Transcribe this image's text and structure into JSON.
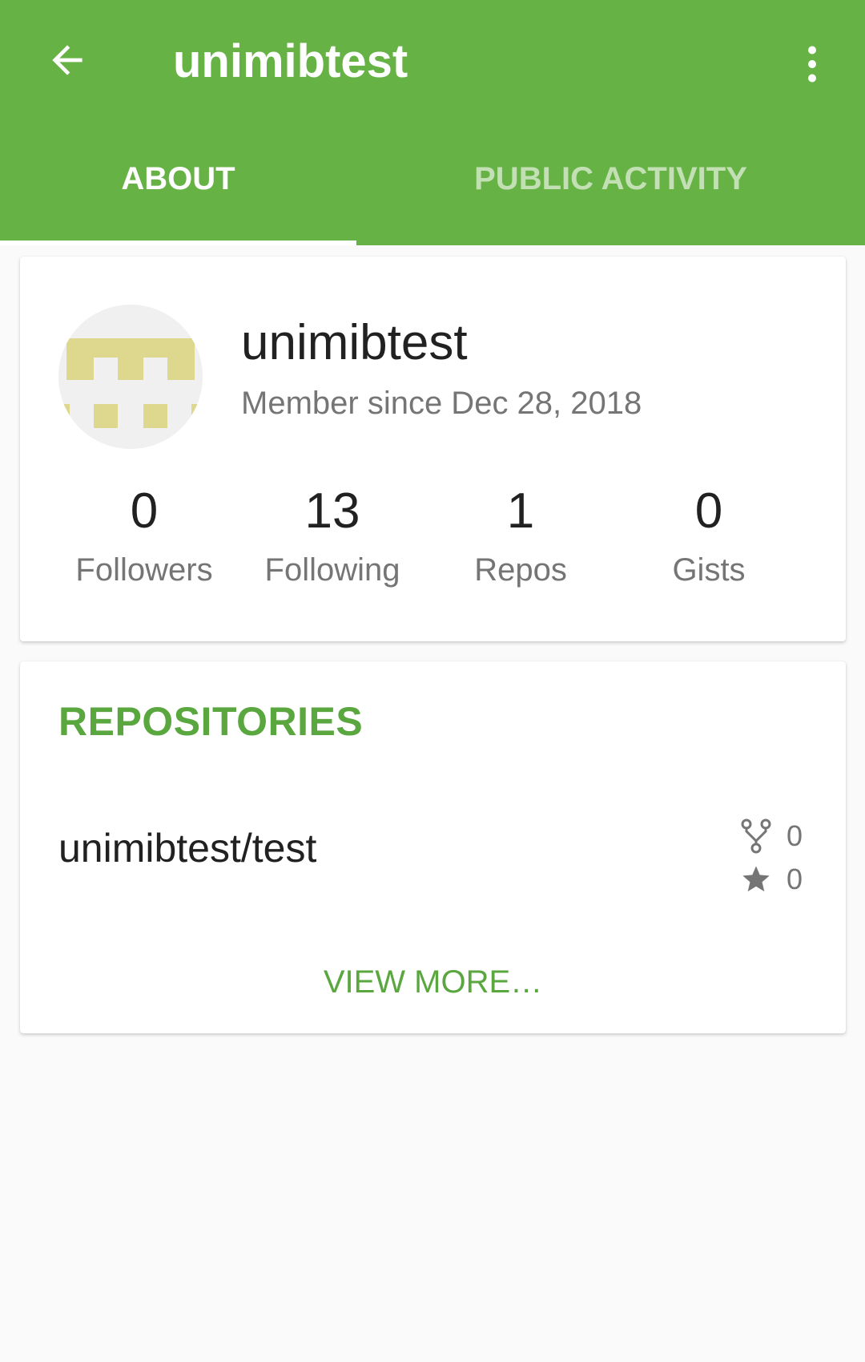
{
  "colors": {
    "primary": "#66b245",
    "accent_text": "#5aa63f",
    "background": "#fafafa",
    "card": "#ffffff",
    "avatar_pattern": "#ddd88e"
  },
  "toolbar": {
    "back_icon": "arrow-back-icon",
    "title": "unimibtest",
    "menu_icon": "more-vert-icon"
  },
  "tabs": [
    {
      "label": "ABOUT",
      "selected": true
    },
    {
      "label": "PUBLIC ACTIVITY",
      "selected": false
    }
  ],
  "profile": {
    "name": "unimibtest",
    "member_since": "Member since Dec 28, 2018",
    "stats": [
      {
        "value": "0",
        "label": "Followers"
      },
      {
        "value": "13",
        "label": "Following"
      },
      {
        "value": "1",
        "label": "Repos"
      },
      {
        "value": "0",
        "label": "Gists"
      }
    ]
  },
  "repositories": {
    "heading": "REPOSITORIES",
    "items": [
      {
        "name": "unimibtest/test",
        "forks": "0",
        "stars": "0"
      }
    ],
    "view_more": "VIEW MORE…"
  }
}
